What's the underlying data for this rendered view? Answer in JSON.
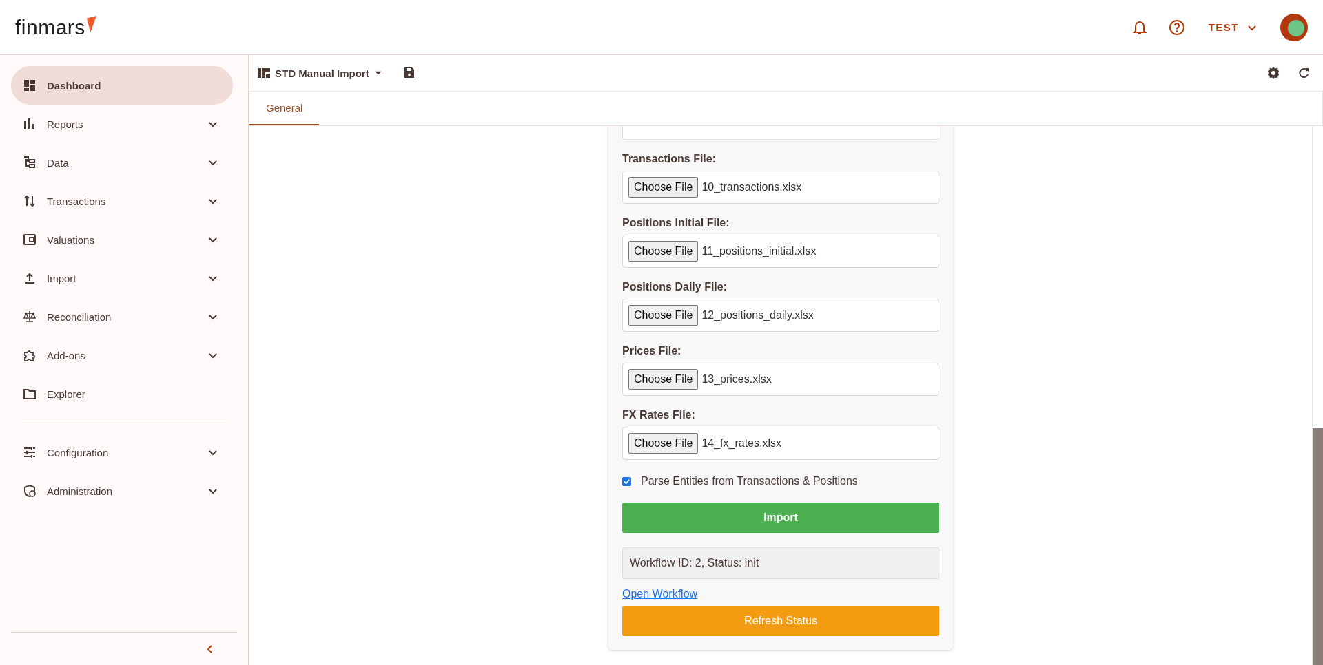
{
  "header": {
    "logo": "finmars",
    "user": "TEST"
  },
  "sidebar": {
    "groups": [
      {
        "items": [
          {
            "label": "Dashboard",
            "selected": true,
            "expandable": false
          },
          {
            "label": "Reports",
            "selected": false,
            "expandable": true
          },
          {
            "label": "Data",
            "selected": false,
            "expandable": true
          },
          {
            "label": "Transactions",
            "selected": false,
            "expandable": true
          },
          {
            "label": "Valuations",
            "selected": false,
            "expandable": true
          },
          {
            "label": "Import",
            "selected": false,
            "expandable": true
          },
          {
            "label": "Reconciliation",
            "selected": false,
            "expandable": true
          },
          {
            "label": "Add-ons",
            "selected": false,
            "expandable": true
          },
          {
            "label": "Explorer",
            "selected": false,
            "expandable": false
          }
        ]
      },
      {
        "items": [
          {
            "label": "Configuration",
            "selected": false,
            "expandable": true
          },
          {
            "label": "Administration",
            "selected": false,
            "expandable": true
          }
        ]
      }
    ]
  },
  "toolbar": {
    "layout_name": "STD Manual Import"
  },
  "tabs": [
    {
      "label": "General",
      "selected": true
    }
  ],
  "form": {
    "fields": [
      {
        "label": "Transactions File:",
        "button": "Choose File",
        "filename": "10_transactions.xlsx"
      },
      {
        "label": "Positions Initial File:",
        "button": "Choose File",
        "filename": "11_positions_initial.xlsx"
      },
      {
        "label": "Positions Daily File:",
        "button": "Choose File",
        "filename": "12_positions_daily.xlsx"
      },
      {
        "label": "Prices File:",
        "button": "Choose File",
        "filename": "13_prices.xlsx"
      },
      {
        "label": "FX Rates File:",
        "button": "Choose File",
        "filename": "14_fx_rates.xlsx"
      }
    ],
    "option": {
      "label": "Parse Entities from Transactions & Positions",
      "checked": true
    },
    "import_button": "Import",
    "status": "Workflow ID: 2, Status: init",
    "link": "Open Workflow",
    "refresh_button": "Refresh Status"
  }
}
